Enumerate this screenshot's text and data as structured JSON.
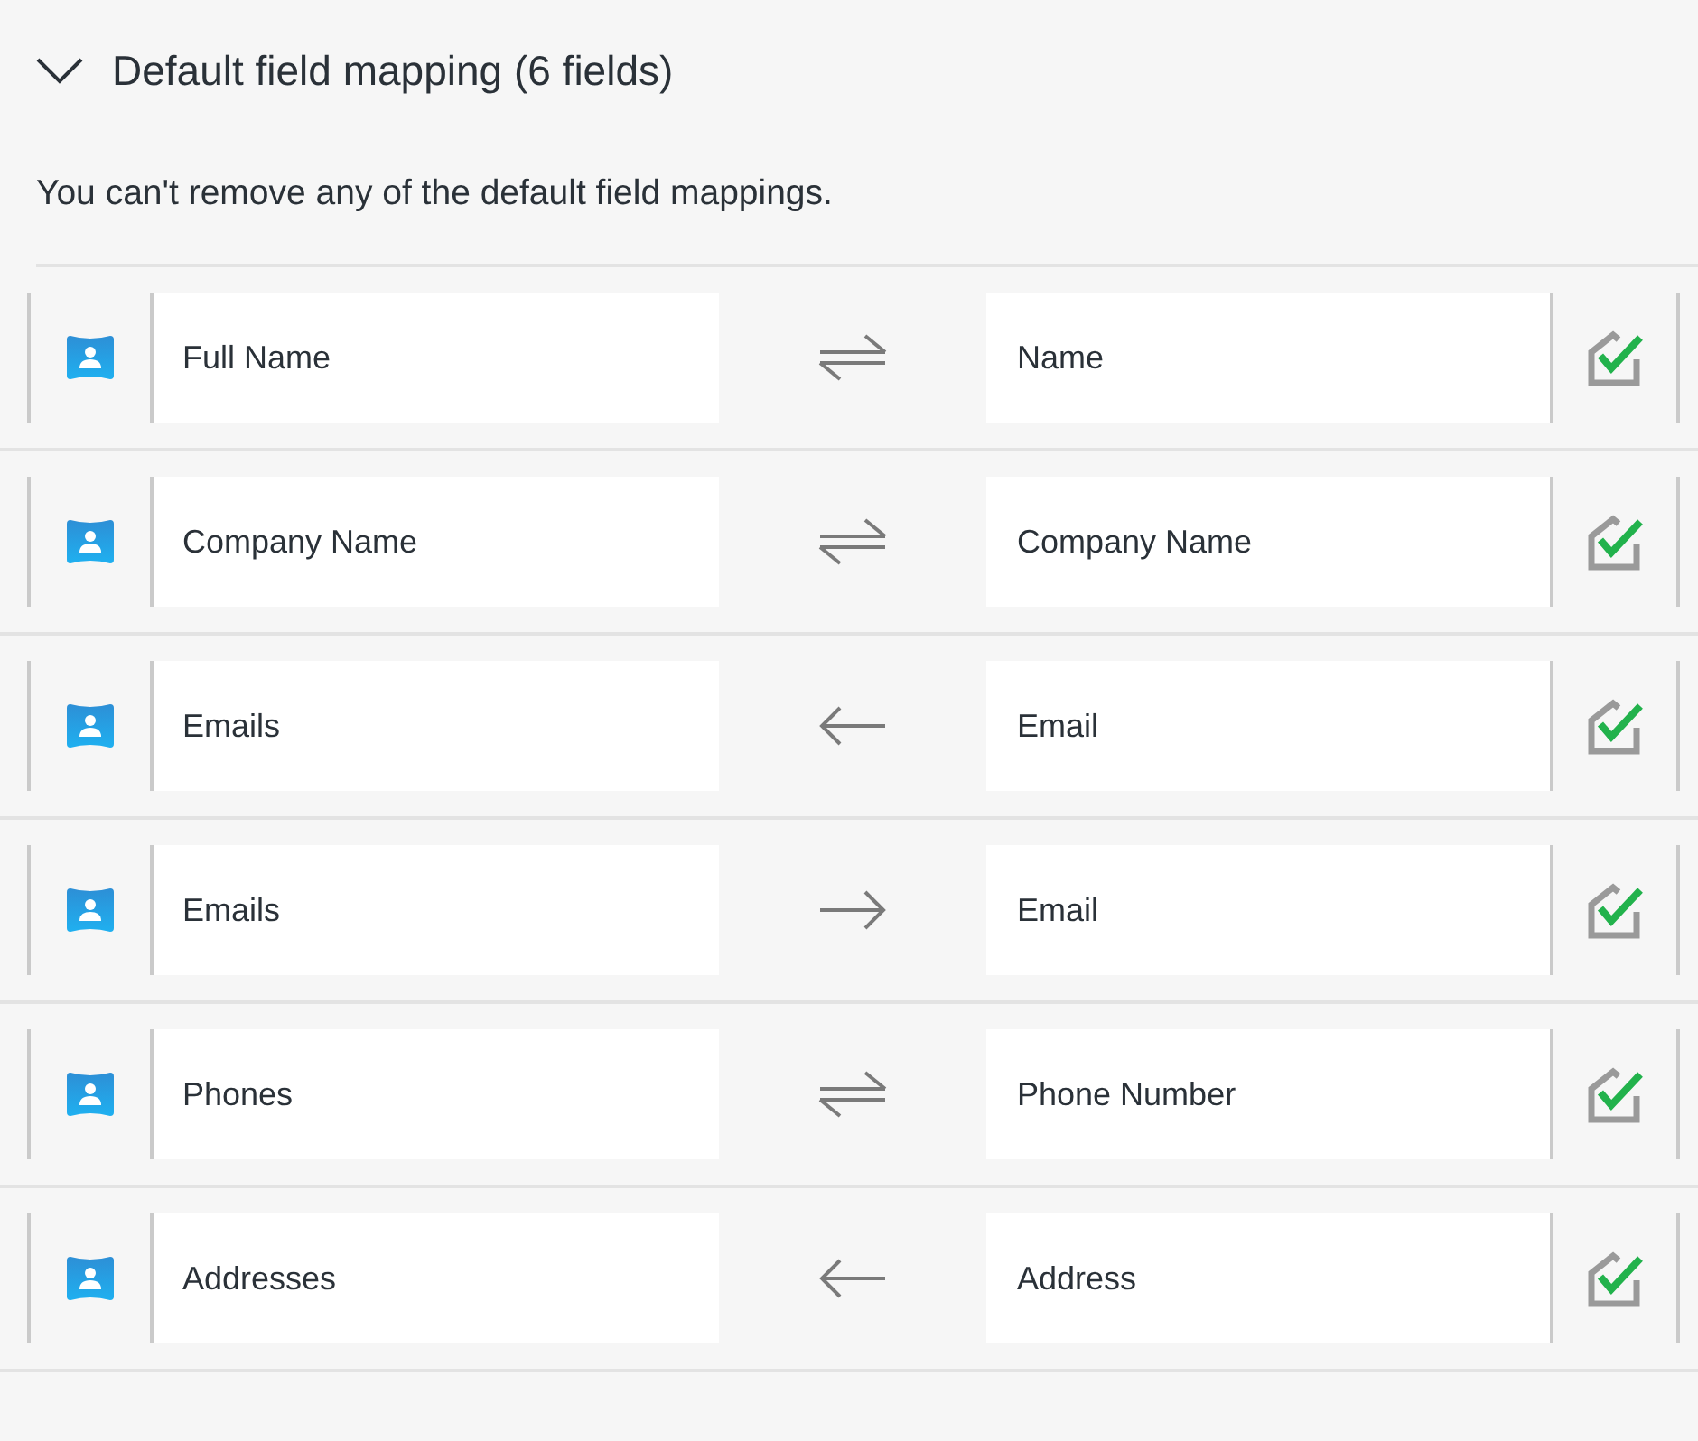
{
  "section": {
    "title": "Default field mapping (6 fields)",
    "expanded": true
  },
  "note": "You can't remove any of the default field mappings.",
  "mappings": [
    {
      "source": "Full Name",
      "kind": "both",
      "target": "Name"
    },
    {
      "source": "Company Name",
      "kind": "both",
      "target": "Company Name"
    },
    {
      "source": "Emails",
      "kind": "left",
      "target": "Email"
    },
    {
      "source": "Emails",
      "kind": "right",
      "target": "Email"
    },
    {
      "source": "Phones",
      "kind": "both",
      "target": "Phone Number"
    },
    {
      "source": "Addresses",
      "kind": "left",
      "target": "Address"
    }
  ]
}
